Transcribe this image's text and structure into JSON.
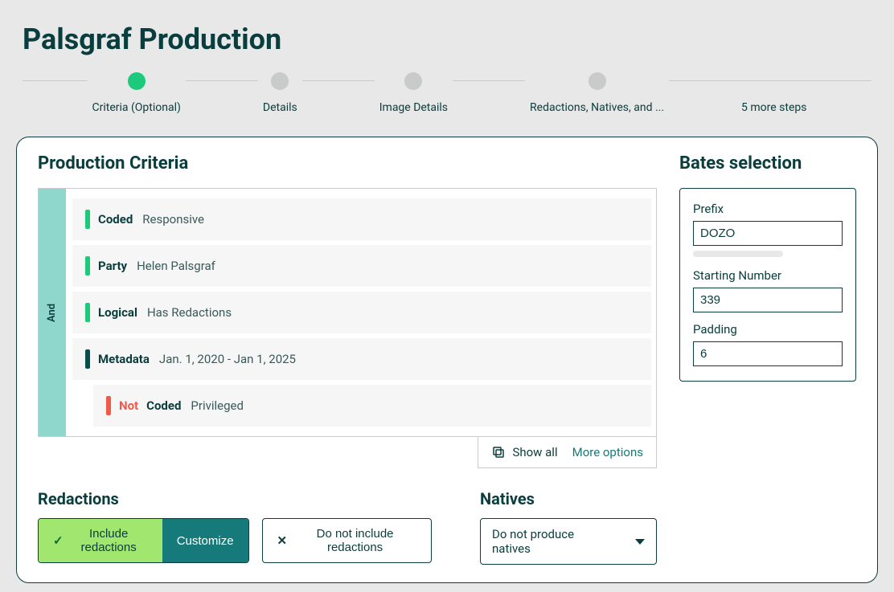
{
  "page": {
    "title": "Palsgraf Production"
  },
  "stepper": {
    "steps": [
      {
        "label": "Criteria (Optional)",
        "active": true
      },
      {
        "label": "Details",
        "active": false
      },
      {
        "label": "Image Details",
        "active": false
      },
      {
        "label": "Redactions, Natives, and ...",
        "active": false
      }
    ],
    "overflow_label": "5 more steps"
  },
  "criteria": {
    "section_title": "Production Criteria",
    "operator_label": "And",
    "rows": [
      {
        "bar": "green",
        "label": "Coded",
        "value": "Responsive",
        "not": false,
        "nested": false
      },
      {
        "bar": "green",
        "label": "Party",
        "value": "Helen Palsgraf",
        "not": false,
        "nested": false
      },
      {
        "bar": "green",
        "label": "Logical",
        "value": "Has Redactions",
        "not": false,
        "nested": false
      },
      {
        "bar": "dark",
        "label": "Metadata",
        "value": "Jan. 1, 2020 - Jan 1, 2025",
        "not": false,
        "nested": false
      },
      {
        "bar": "red",
        "label": "Coded",
        "value": "Privileged",
        "not": true,
        "nested": true
      }
    ],
    "not_label": "Not",
    "show_all_label": "Show all",
    "more_options_label": "More options"
  },
  "bates": {
    "section_title": "Bates selection",
    "prefix_label": "Prefix",
    "prefix_value": "DOZO",
    "starting_label": "Starting Number",
    "starting_value": "339",
    "padding_label": "Padding",
    "padding_value": "6"
  },
  "redactions": {
    "section_title": "Redactions",
    "include_label": "Include redactions",
    "customize_label": "Customize",
    "exclude_label": "Do not include redactions"
  },
  "natives": {
    "section_title": "Natives",
    "selected_label": "Do not produce natives"
  }
}
